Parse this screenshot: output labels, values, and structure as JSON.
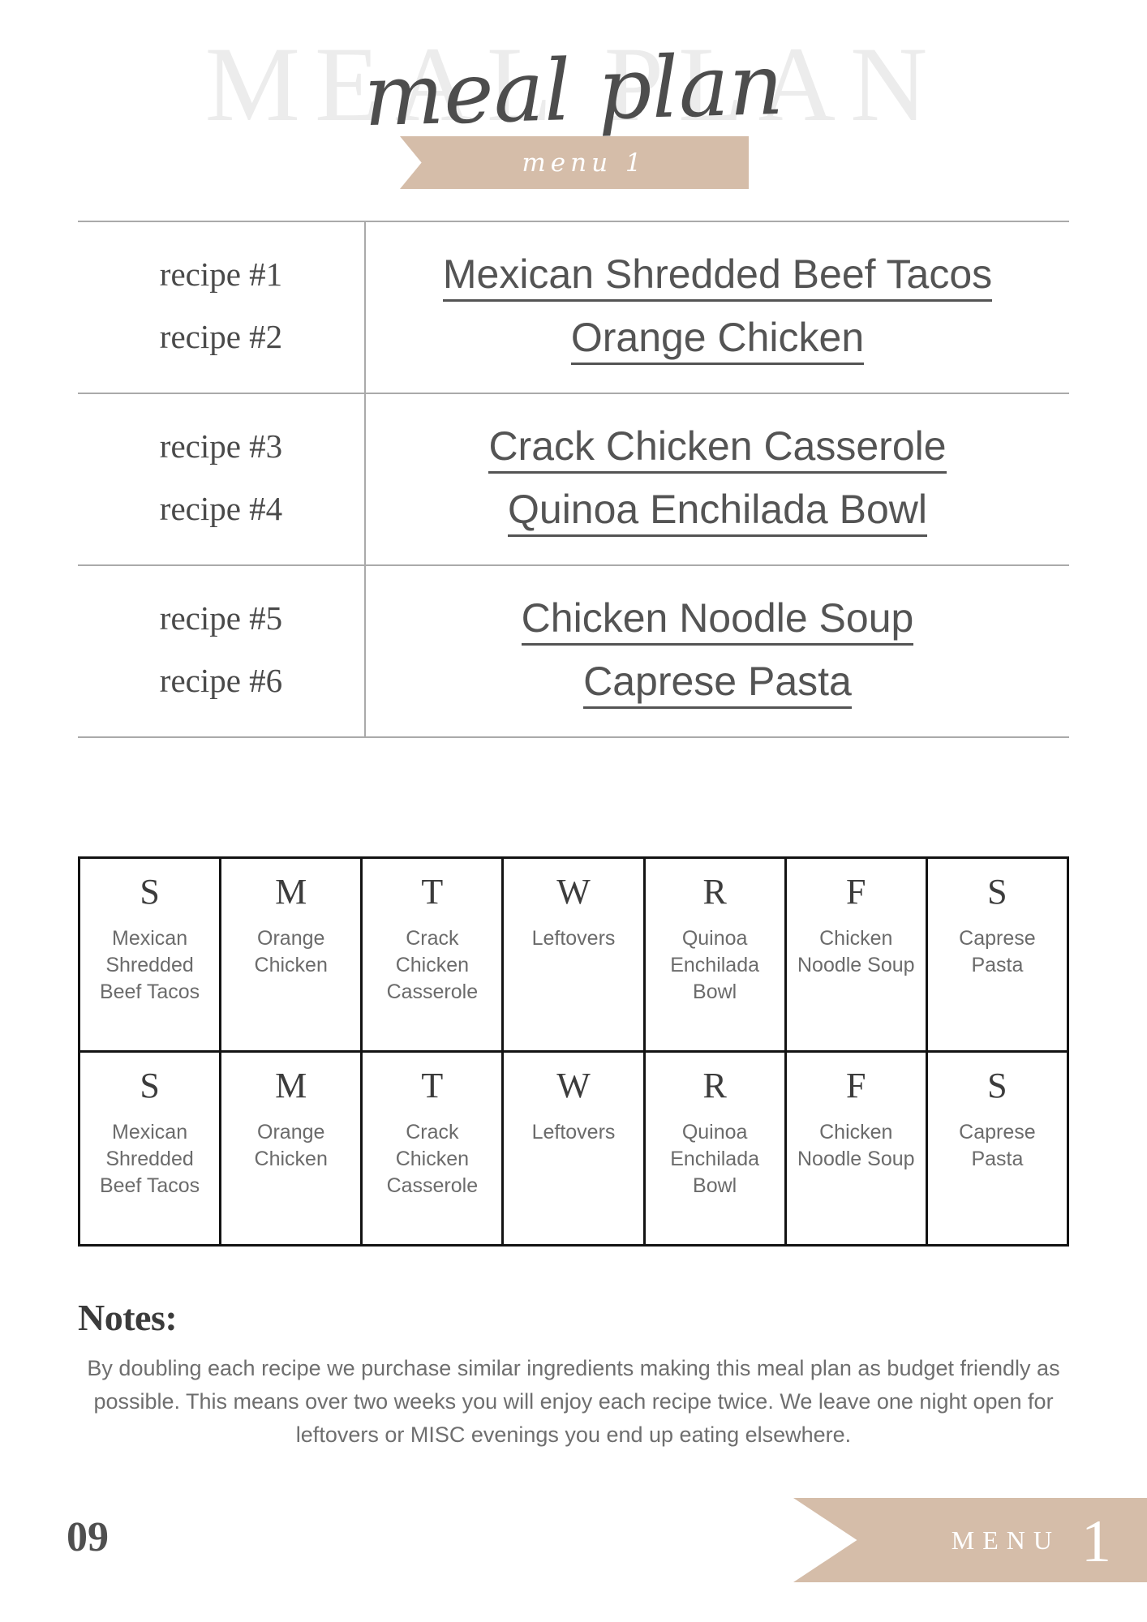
{
  "header": {
    "ghost_title": "MEAL PLAN",
    "script_title": "meal plan",
    "banner_label": "menu 1"
  },
  "colors": {
    "ribbon_tan": "#d5bda9",
    "ghost_title_gray": "#ececec",
    "text_dark": "#4a4a4a",
    "divider_gray": "#aaaaaa",
    "grid_black": "#131313"
  },
  "recipes": {
    "groups": [
      {
        "labels": [
          "recipe #1",
          "recipe #2"
        ],
        "names": [
          "Mexican Shredded Beef Tacos",
          "Orange Chicken"
        ]
      },
      {
        "labels": [
          "recipe #3",
          "recipe #4"
        ],
        "names": [
          "Crack Chicken Casserole",
          "Quinoa Enchilada Bowl"
        ]
      },
      {
        "labels": [
          "recipe #5",
          "recipe #6"
        ],
        "names": [
          "Chicken Noodle Soup",
          "Caprese Pasta"
        ]
      }
    ]
  },
  "calendar": {
    "weeks": [
      {
        "days": [
          {
            "letter": "S",
            "meal": "Mexican Shredded Beef Tacos"
          },
          {
            "letter": "M",
            "meal": "Orange Chicken"
          },
          {
            "letter": "T",
            "meal": "Crack Chicken Casserole"
          },
          {
            "letter": "W",
            "meal": "Leftovers"
          },
          {
            "letter": "R",
            "meal": "Quinoa Enchilada Bowl"
          },
          {
            "letter": "F",
            "meal": "Chicken Noodle Soup"
          },
          {
            "letter": "S",
            "meal": "Caprese Pasta"
          }
        ]
      },
      {
        "days": [
          {
            "letter": "S",
            "meal": "Mexican Shredded Beef Tacos"
          },
          {
            "letter": "M",
            "meal": "Orange Chicken"
          },
          {
            "letter": "T",
            "meal": "Crack Chicken Casserole"
          },
          {
            "letter": "W",
            "meal": "Leftovers"
          },
          {
            "letter": "R",
            "meal": "Quinoa Enchilada Bowl"
          },
          {
            "letter": "F",
            "meal": "Chicken Noodle Soup"
          },
          {
            "letter": "S",
            "meal": "Caprese Pasta"
          }
        ]
      }
    ]
  },
  "notes": {
    "title": "Notes:",
    "body": "By doubling each recipe we purchase similar ingredients making this meal plan as budget friendly as possible. This means over two weeks you will enjoy each recipe twice. We leave one night open for leftovers or MISC evenings you end up eating elsewhere."
  },
  "footer": {
    "page_number": "09",
    "menu_word": "MENU",
    "menu_number": "1"
  }
}
